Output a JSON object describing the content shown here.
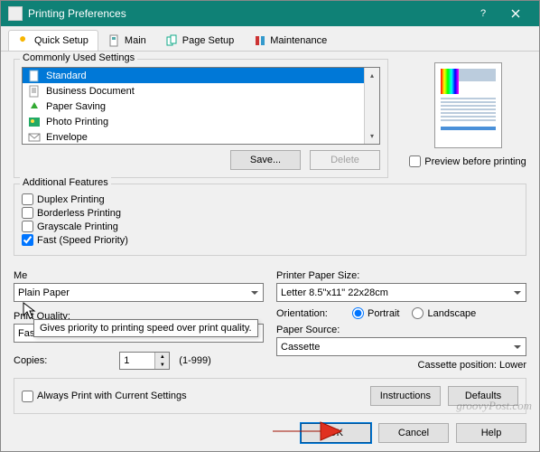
{
  "window": {
    "title": "Printing Preferences"
  },
  "tabs": {
    "quick": "Quick Setup",
    "main": "Main",
    "page": "Page Setup",
    "maint": "Maintenance"
  },
  "commonly": {
    "legend": "Commonly Used Settings",
    "items": [
      "Standard",
      "Business Document",
      "Paper Saving",
      "Photo Printing",
      "Envelope"
    ],
    "save": "Save...",
    "delete": "Delete"
  },
  "preview": {
    "label": "Preview before printing"
  },
  "additional": {
    "legend": "Additional Features",
    "duplex": "Duplex Printing",
    "borderless": "Borderless Printing",
    "grayscale": "Grayscale Printing",
    "fast": "Fast (Speed Priority)"
  },
  "tooltip": "Gives priority to printing speed over print quality.",
  "media": {
    "label_short": "Me",
    "value": "Plain Paper"
  },
  "quality": {
    "label": "Print Quality:",
    "value": "Fast"
  },
  "copies": {
    "label": "Copies:",
    "value": "1",
    "range": "(1-999)"
  },
  "paper_size": {
    "label": "Printer Paper Size:",
    "value": "Letter 8.5\"x11\" 22x28cm"
  },
  "orientation": {
    "label": "Orientation:",
    "portrait": "Portrait",
    "landscape": "Landscape"
  },
  "source": {
    "label": "Paper Source:",
    "value": "Cassette",
    "cassette_note": "Cassette position: Lower"
  },
  "always": "Always Print with Current Settings",
  "bottom": {
    "instructions": "Instructions",
    "defaults": "Defaults"
  },
  "dlg": {
    "ok": "OK",
    "cancel": "Cancel",
    "help": "Help"
  },
  "watermark": "groovyPost.com"
}
